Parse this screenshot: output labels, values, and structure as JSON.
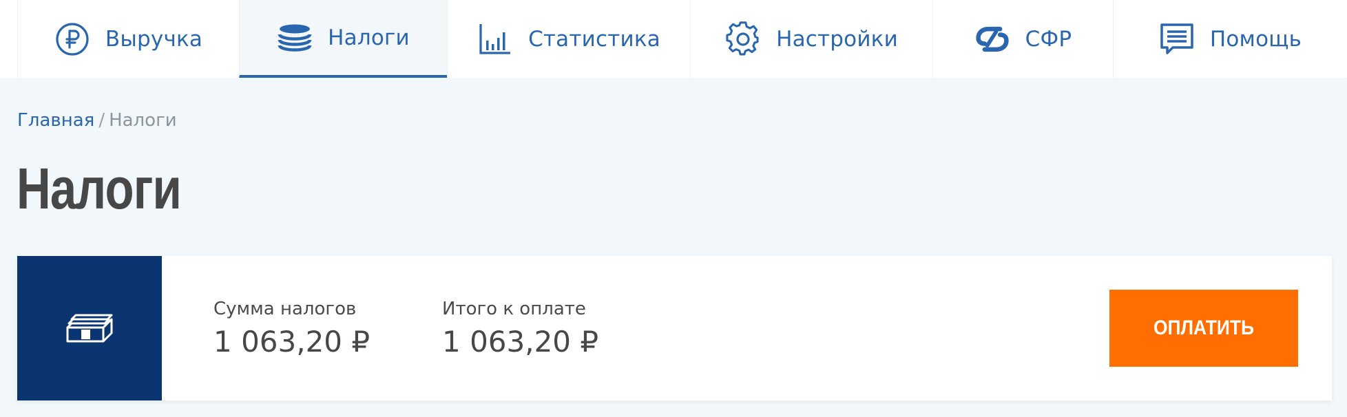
{
  "nav": {
    "items": [
      {
        "label": "Выручка",
        "icon": "ruble-icon",
        "active": false
      },
      {
        "label": "Налоги",
        "icon": "coins-stack-icon",
        "active": true
      },
      {
        "label": "Статистика",
        "icon": "bar-chart-icon",
        "active": false
      },
      {
        "label": "Настройки",
        "icon": "gear-icon",
        "active": false
      },
      {
        "label": "СФР",
        "icon": "sfr-logo-icon",
        "active": false
      },
      {
        "label": "Помощь",
        "icon": "help-chat-icon",
        "active": false
      }
    ]
  },
  "breadcrumb": {
    "home": "Главная",
    "separator": "/",
    "current": "Налоги"
  },
  "page": {
    "title": "Налоги"
  },
  "summary": {
    "icon": "banknotes-icon",
    "tax_sum_label": "Сумма налогов",
    "tax_sum_value": "1 063,20 ₽",
    "total_label": "Итого к оплате",
    "total_value": "1 063,20 ₽",
    "pay_button": "ОПЛАТИТЬ"
  },
  "colors": {
    "accent": "#2a66b0",
    "card_icon_bg": "#0b3571",
    "pay_button": "#ff6e00",
    "page_bg": "#f1f7fa"
  }
}
